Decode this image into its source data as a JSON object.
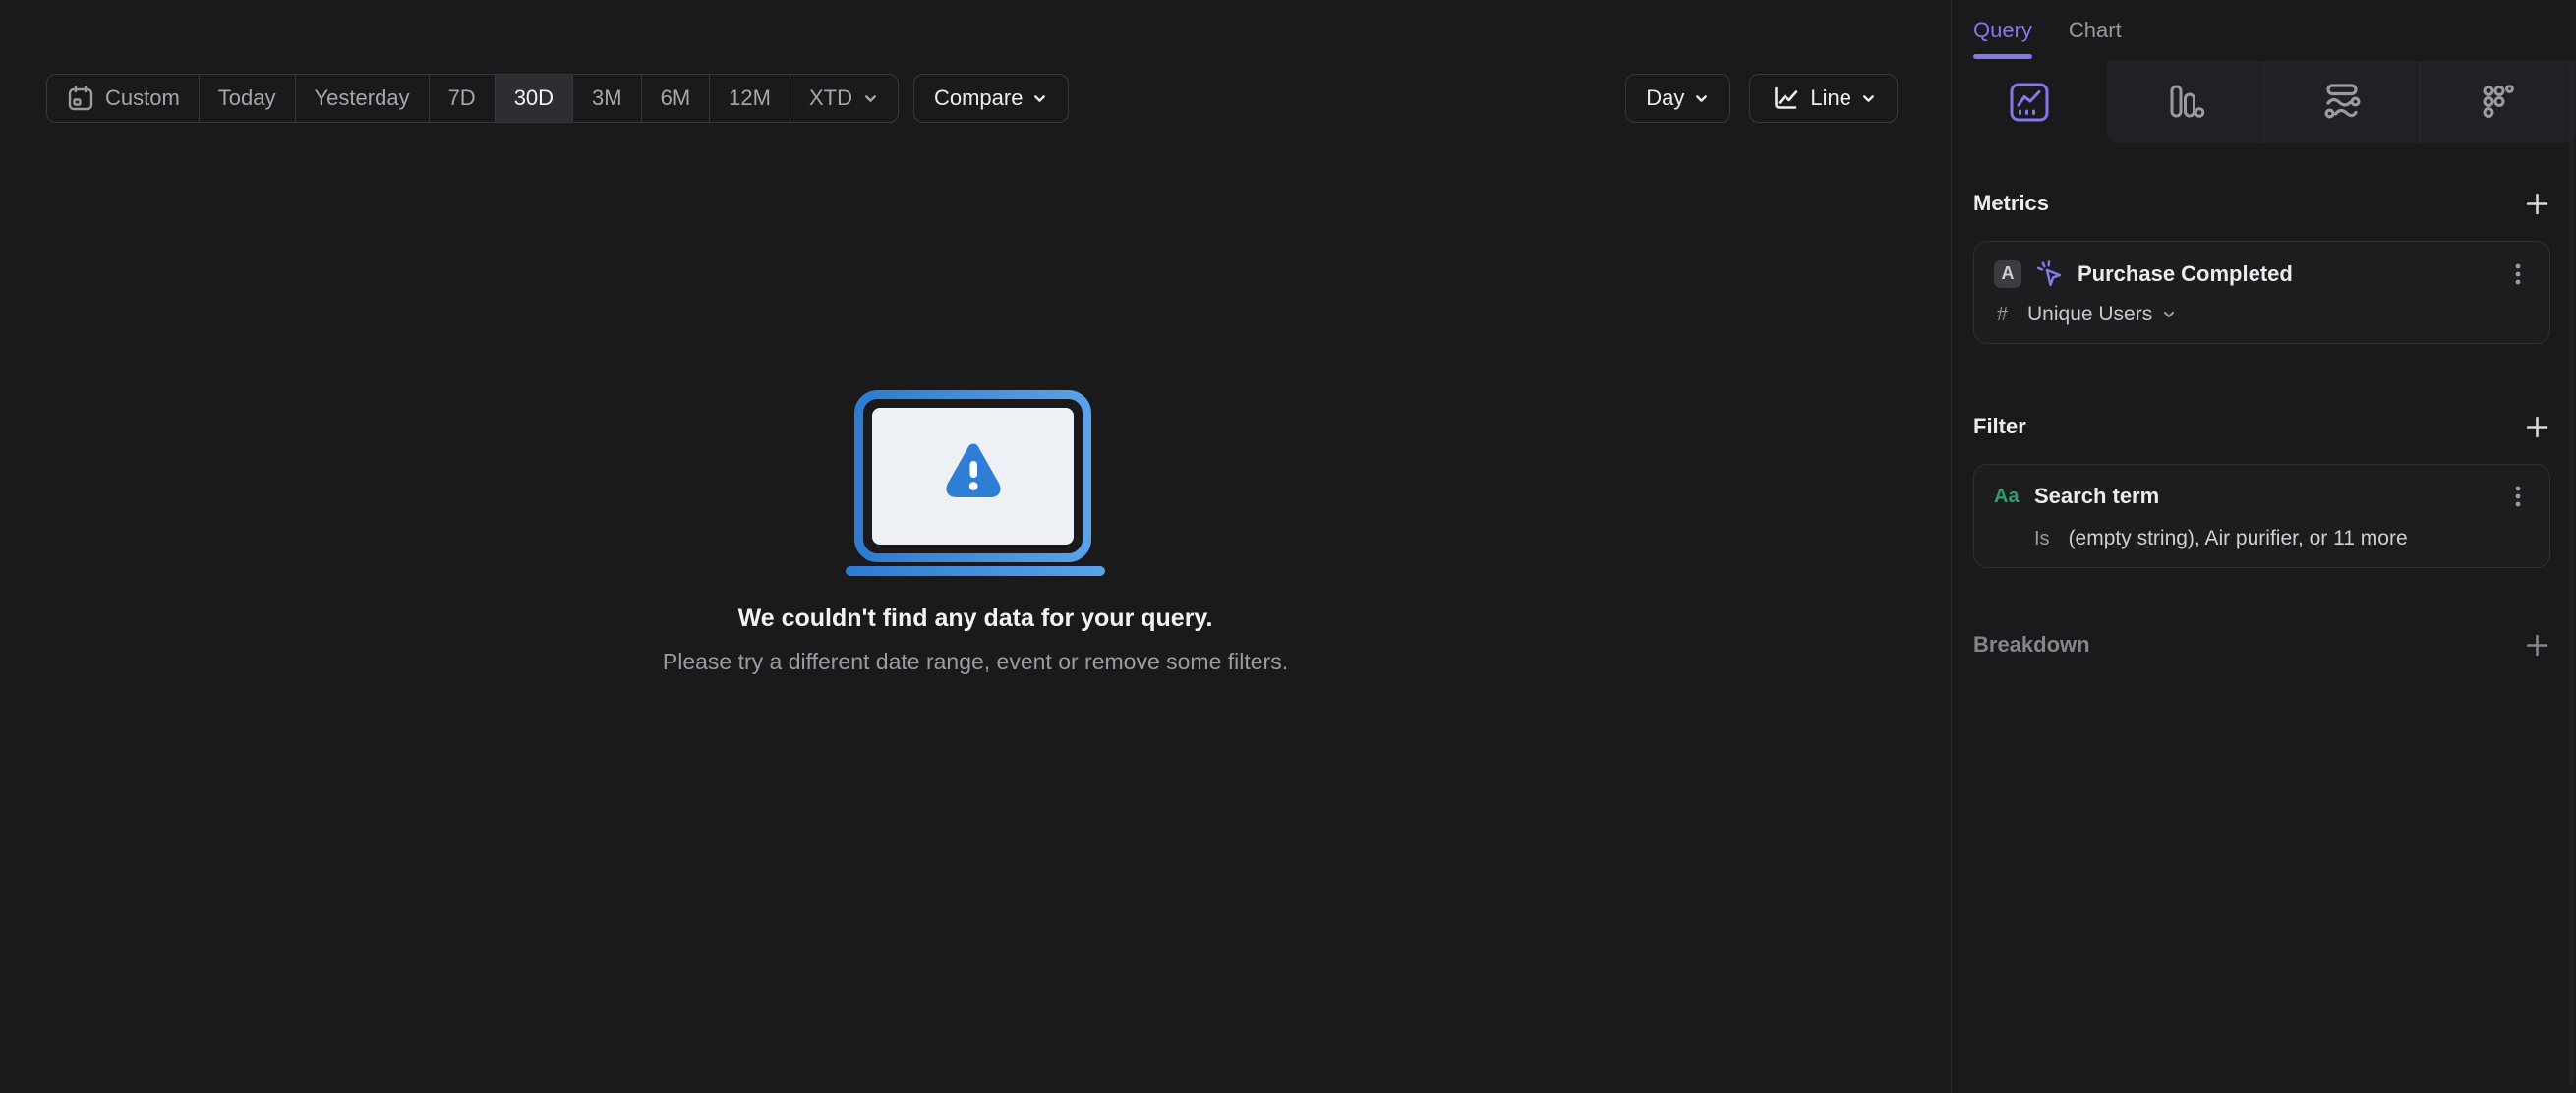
{
  "toolbar": {
    "date_ranges": [
      "Custom",
      "Today",
      "Yesterday",
      "7D",
      "30D",
      "3M",
      "6M",
      "12M",
      "XTD"
    ],
    "selected_range": "30D",
    "compare_label": "Compare",
    "granularity_label": "Day",
    "chart_style_label": "Line",
    "icons": [
      "calendar-icon",
      "chevron-down-icon",
      "line-chart-icon"
    ]
  },
  "empty_state": {
    "title": "We couldn't find any data for your query.",
    "subtitle": "Please try a different date range, event or remove some filters.",
    "illustration": "laptop-warning-illustration"
  },
  "sidebar": {
    "tabs": [
      {
        "label": "Query",
        "active": true
      },
      {
        "label": "Chart",
        "active": false
      }
    ],
    "chart_type_icons": [
      "insights-line-icon",
      "bar-chart-icon",
      "flow-icon",
      "retention-dots-icon"
    ],
    "active_chart_type": "insights-line",
    "metrics": {
      "header": "Metrics",
      "item": {
        "series_letter": "A",
        "event_icon": "click-event-icon",
        "name": "Purchase Completed",
        "aggregation_symbol": "#",
        "aggregation": "Unique Users"
      }
    },
    "filter": {
      "header": "Filter",
      "item": {
        "type_label": "Aa",
        "property": "Search term",
        "operator": "Is",
        "values": "(empty string), Air purifier, or 11 more"
      }
    },
    "breakdown": {
      "header": "Breakdown"
    }
  },
  "colors": {
    "accent_purple": "#8379ea",
    "accent_green": "#2f9e68",
    "accent_blue": "#2e7ed6",
    "background": "#1a1a1c",
    "selected_segment": "#2d2e33",
    "card_border": "#2f2f34"
  }
}
